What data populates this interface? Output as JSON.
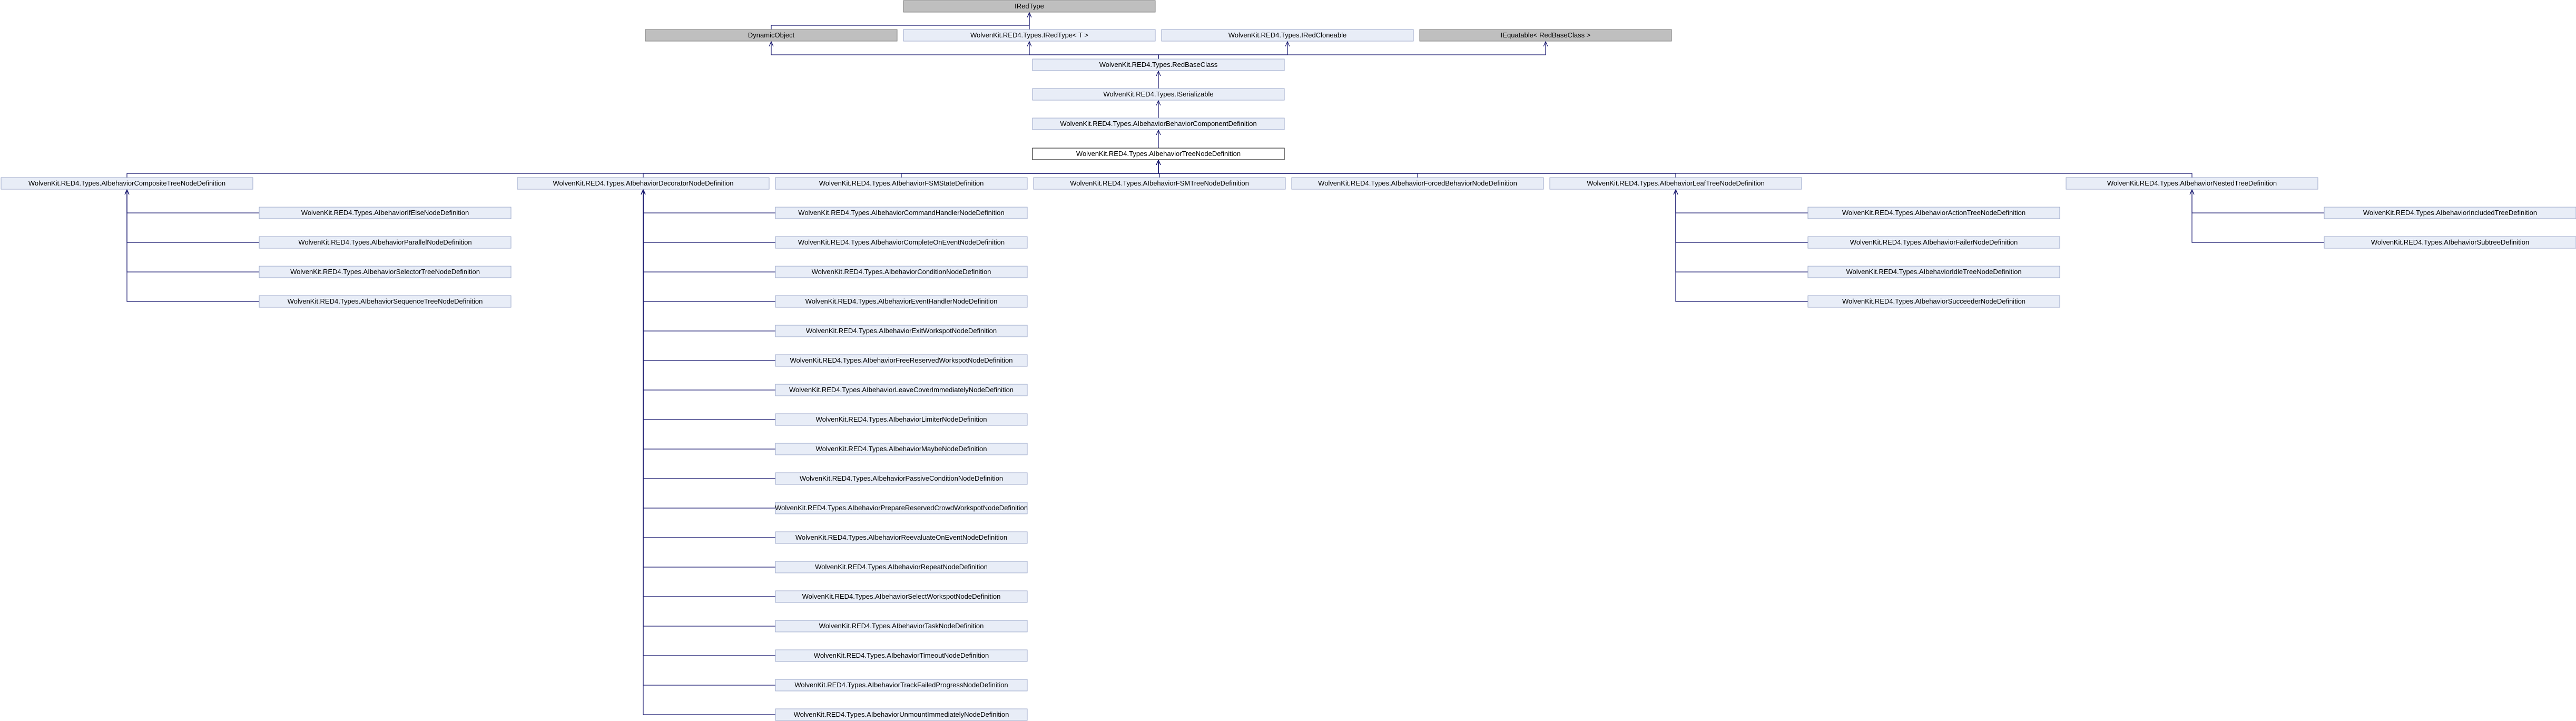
{
  "diagram": {
    "type": "class-inheritance-graph",
    "colors": {
      "node_fill": "#e8edf7",
      "node_stroke": "#9aa6c8",
      "external_fill": "#bfbfbf",
      "external_stroke": "#7a7a7a",
      "focus_fill": "#ffffff",
      "focus_stroke": "#000000",
      "edge": "#191970"
    },
    "nodes": [
      {
        "id": "iredtype",
        "label": "IRedType",
        "kind": "external"
      },
      {
        "id": "dynamicobject",
        "label": "DynamicObject",
        "kind": "external"
      },
      {
        "id": "iredtypet",
        "label": "WolvenKit.RED4.Types.IRedType< T >",
        "kind": "normal"
      },
      {
        "id": "iredcloneable",
        "label": "WolvenKit.RED4.Types.IRedCloneable",
        "kind": "normal"
      },
      {
        "id": "iequatable",
        "label": "IEquatable< RedBaseClass >",
        "kind": "external"
      },
      {
        "id": "redbaseclass",
        "label": "WolvenKit.RED4.Types.RedBaseClass",
        "kind": "normal"
      },
      {
        "id": "iserializable",
        "label": "WolvenKit.RED4.Types.ISerializable",
        "kind": "normal"
      },
      {
        "id": "behaviorcomponent",
        "label": "WolvenKit.RED4.Types.AIbehaviorBehaviorComponentDefinition",
        "kind": "normal"
      },
      {
        "id": "treenode",
        "label": "WolvenKit.RED4.Types.AIbehaviorTreeNodeDefinition",
        "kind": "focus"
      },
      {
        "id": "composite",
        "label": "WolvenKit.RED4.Types.AIbehaviorCompositeTreeNodeDefinition",
        "kind": "normal"
      },
      {
        "id": "decorator",
        "label": "WolvenKit.RED4.Types.AIbehaviorDecoratorNodeDefinition",
        "kind": "normal"
      },
      {
        "id": "fsmstate",
        "label": "WolvenKit.RED4.Types.AIbehaviorFSMStateDefinition",
        "kind": "normal"
      },
      {
        "id": "fsmtree",
        "label": "WolvenKit.RED4.Types.AIbehaviorFSMTreeNodeDefinition",
        "kind": "normal"
      },
      {
        "id": "forced",
        "label": "WolvenKit.RED4.Types.AIbehaviorForcedBehaviorNodeDefinition",
        "kind": "normal"
      },
      {
        "id": "leaf",
        "label": "WolvenKit.RED4.Types.AIbehaviorLeafTreeNodeDefinition",
        "kind": "normal"
      },
      {
        "id": "nested",
        "label": "WolvenKit.RED4.Types.AIbehaviorNestedTreeDefinition",
        "kind": "normal"
      },
      {
        "id": "ifelse",
        "label": "WolvenKit.RED4.Types.AIbehaviorIfElseNodeDefinition",
        "kind": "normal"
      },
      {
        "id": "parallel",
        "label": "WolvenKit.RED4.Types.AIbehaviorParallelNodeDefinition",
        "kind": "normal"
      },
      {
        "id": "selector",
        "label": "WolvenKit.RED4.Types.AIbehaviorSelectorTreeNodeDefinition",
        "kind": "normal"
      },
      {
        "id": "sequence",
        "label": "WolvenKit.RED4.Types.AIbehaviorSequenceTreeNodeDefinition",
        "kind": "normal"
      },
      {
        "id": "cmdhandler",
        "label": "WolvenKit.RED4.Types.AIbehaviorCommandHandlerNodeDefinition",
        "kind": "normal"
      },
      {
        "id": "completeon",
        "label": "WolvenKit.RED4.Types.AIbehaviorCompleteOnEventNodeDefinition",
        "kind": "normal"
      },
      {
        "id": "condition",
        "label": "WolvenKit.RED4.Types.AIbehaviorConditionNodeDefinition",
        "kind": "normal"
      },
      {
        "id": "eventhandler",
        "label": "WolvenKit.RED4.Types.AIbehaviorEventHandlerNodeDefinition",
        "kind": "normal"
      },
      {
        "id": "exitwork",
        "label": "WolvenKit.RED4.Types.AIbehaviorExitWorkspotNodeDefinition",
        "kind": "normal"
      },
      {
        "id": "freereserved",
        "label": "WolvenKit.RED4.Types.AIbehaviorFreeReservedWorkspotNodeDefinition",
        "kind": "normal"
      },
      {
        "id": "leavecover",
        "label": "WolvenKit.RED4.Types.AIbehaviorLeaveCoverImmediatelyNodeDefinition",
        "kind": "normal"
      },
      {
        "id": "limiter",
        "label": "WolvenKit.RED4.Types.AIbehaviorLimiterNodeDefinition",
        "kind": "normal"
      },
      {
        "id": "maybe",
        "label": "WolvenKit.RED4.Types.AIbehaviorMaybeNodeDefinition",
        "kind": "normal"
      },
      {
        "id": "passive",
        "label": "WolvenKit.RED4.Types.AIbehaviorPassiveConditionNodeDefinition",
        "kind": "normal"
      },
      {
        "id": "prepare",
        "label": "WolvenKit.RED4.Types.AIbehaviorPrepareReservedCrowdWorkspotNodeDefinition",
        "kind": "normal"
      },
      {
        "id": "reevaluate",
        "label": "WolvenKit.RED4.Types.AIbehaviorReevaluateOnEventNodeDefinition",
        "kind": "normal"
      },
      {
        "id": "repeat",
        "label": "WolvenKit.RED4.Types.AIbehaviorRepeatNodeDefinition",
        "kind": "normal"
      },
      {
        "id": "selectwork",
        "label": "WolvenKit.RED4.Types.AIbehaviorSelectWorkspotNodeDefinition",
        "kind": "normal"
      },
      {
        "id": "task",
        "label": "WolvenKit.RED4.Types.AIbehaviorTaskNodeDefinition",
        "kind": "normal"
      },
      {
        "id": "timeout",
        "label": "WolvenKit.RED4.Types.AIbehaviorTimeoutNodeDefinition",
        "kind": "normal"
      },
      {
        "id": "trackfailed",
        "label": "WolvenKit.RED4.Types.AIbehaviorTrackFailedProgressNodeDefinition",
        "kind": "normal"
      },
      {
        "id": "unmount",
        "label": "WolvenKit.RED4.Types.AIbehaviorUnmountImmediatelyNodeDefinition",
        "kind": "normal"
      },
      {
        "id": "action",
        "label": "WolvenKit.RED4.Types.AIbehaviorActionTreeNodeDefinition",
        "kind": "normal"
      },
      {
        "id": "failer",
        "label": "WolvenKit.RED4.Types.AIbehaviorFailerNodeDefinition",
        "kind": "normal"
      },
      {
        "id": "idle",
        "label": "WolvenKit.RED4.Types.AIbehaviorIdleTreeNodeDefinition",
        "kind": "normal"
      },
      {
        "id": "succeeder",
        "label": "WolvenKit.RED4.Types.AIbehaviorSucceederNodeDefinition",
        "kind": "normal"
      },
      {
        "id": "included",
        "label": "WolvenKit.RED4.Types.AIbehaviorIncludedTreeDefinition",
        "kind": "normal"
      },
      {
        "id": "subtree",
        "label": "WolvenKit.RED4.Types.AIbehaviorSubtreeDefinition",
        "kind": "normal"
      }
    ],
    "edges": [
      {
        "from": "dynamicobject",
        "to": "iredtype"
      },
      {
        "from": "iredtypet",
        "to": "iredtype"
      },
      {
        "from": "redbaseclass",
        "to": "dynamicobject"
      },
      {
        "from": "redbaseclass",
        "to": "iredtypet"
      },
      {
        "from": "redbaseclass",
        "to": "iredcloneable"
      },
      {
        "from": "redbaseclass",
        "to": "iequatable"
      },
      {
        "from": "iserializable",
        "to": "redbaseclass"
      },
      {
        "from": "behaviorcomponent",
        "to": "iserializable"
      },
      {
        "from": "treenode",
        "to": "behaviorcomponent"
      },
      {
        "from": "composite",
        "to": "treenode"
      },
      {
        "from": "decorator",
        "to": "treenode"
      },
      {
        "from": "fsmstate",
        "to": "treenode"
      },
      {
        "from": "fsmtree",
        "to": "treenode"
      },
      {
        "from": "forced",
        "to": "treenode"
      },
      {
        "from": "leaf",
        "to": "treenode"
      },
      {
        "from": "nested",
        "to": "treenode"
      },
      {
        "from": "ifelse",
        "to": "composite"
      },
      {
        "from": "parallel",
        "to": "composite"
      },
      {
        "from": "selector",
        "to": "composite"
      },
      {
        "from": "sequence",
        "to": "composite"
      },
      {
        "from": "cmdhandler",
        "to": "decorator"
      },
      {
        "from": "completeon",
        "to": "decorator"
      },
      {
        "from": "condition",
        "to": "decorator"
      },
      {
        "from": "eventhandler",
        "to": "decorator"
      },
      {
        "from": "exitwork",
        "to": "decorator"
      },
      {
        "from": "freereserved",
        "to": "decorator"
      },
      {
        "from": "leavecover",
        "to": "decorator"
      },
      {
        "from": "limiter",
        "to": "decorator"
      },
      {
        "from": "maybe",
        "to": "decorator"
      },
      {
        "from": "passive",
        "to": "decorator"
      },
      {
        "from": "prepare",
        "to": "decorator"
      },
      {
        "from": "reevaluate",
        "to": "decorator"
      },
      {
        "from": "repeat",
        "to": "decorator"
      },
      {
        "from": "selectwork",
        "to": "decorator"
      },
      {
        "from": "task",
        "to": "decorator"
      },
      {
        "from": "timeout",
        "to": "decorator"
      },
      {
        "from": "trackfailed",
        "to": "decorator"
      },
      {
        "from": "unmount",
        "to": "decorator"
      },
      {
        "from": "action",
        "to": "leaf"
      },
      {
        "from": "failer",
        "to": "leaf"
      },
      {
        "from": "idle",
        "to": "leaf"
      },
      {
        "from": "succeeder",
        "to": "leaf"
      },
      {
        "from": "included",
        "to": "nested"
      },
      {
        "from": "subtree",
        "to": "nested"
      }
    ]
  }
}
